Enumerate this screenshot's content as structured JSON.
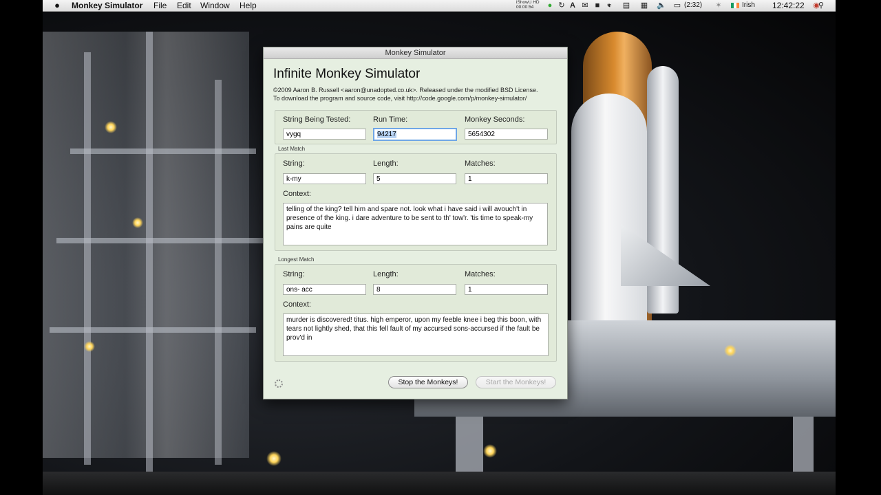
{
  "menubar": {
    "app_name": "Monkey Simulator",
    "menus": [
      "File",
      "Edit",
      "Window",
      "Help"
    ],
    "recording_label": "iShowU HD",
    "recording_time": "00:00:54",
    "battery": "(2:32)",
    "input_source": "Irish",
    "clock": "12:42:22"
  },
  "window": {
    "title": "Monkey Simulator",
    "heading": "Infinite Monkey Simulator",
    "credits_line1": "©2009 Aaron B. Russell <aaron@unadopted.co.uk>. Released under the modified BSD License.",
    "credits_line2": "To download the program and source code, visit http://code.google.com/p/monkey-simulator/"
  },
  "status": {
    "string_label": "String Being Tested:",
    "string_value": "vygq",
    "runtime_label": "Run Time:",
    "runtime_value": "94217",
    "seconds_label": "Monkey Seconds:",
    "seconds_value": "5654302"
  },
  "last_match": {
    "group_label": "Last Match",
    "string_label": "String:",
    "string_value": "k-my",
    "length_label": "Length:",
    "length_value": "5",
    "matches_label": "Matches:",
    "matches_value": "1",
    "context_label": "Context:",
    "context_text": "telling of the king? tell him and spare not. look what i have said i will avouch't in presence of the king. i dare adventure to be sent to th' tow'r. 'tis time to speak-my pains are quite"
  },
  "longest_match": {
    "group_label": "Longest Match",
    "string_label": "String:",
    "string_value": "ons- acc",
    "length_label": "Length:",
    "length_value": "8",
    "matches_label": "Matches:",
    "matches_value": "1",
    "context_label": "Context:",
    "context_text": "murder is discovered! titus. high emperor, upon my feeble knee i beg this boon, with tears not lightly shed, that this fell fault of my accursed sons-accursed if the fault be prov'd in"
  },
  "buttons": {
    "stop": "Stop the Monkeys!",
    "start": "Start the Monkeys!"
  }
}
